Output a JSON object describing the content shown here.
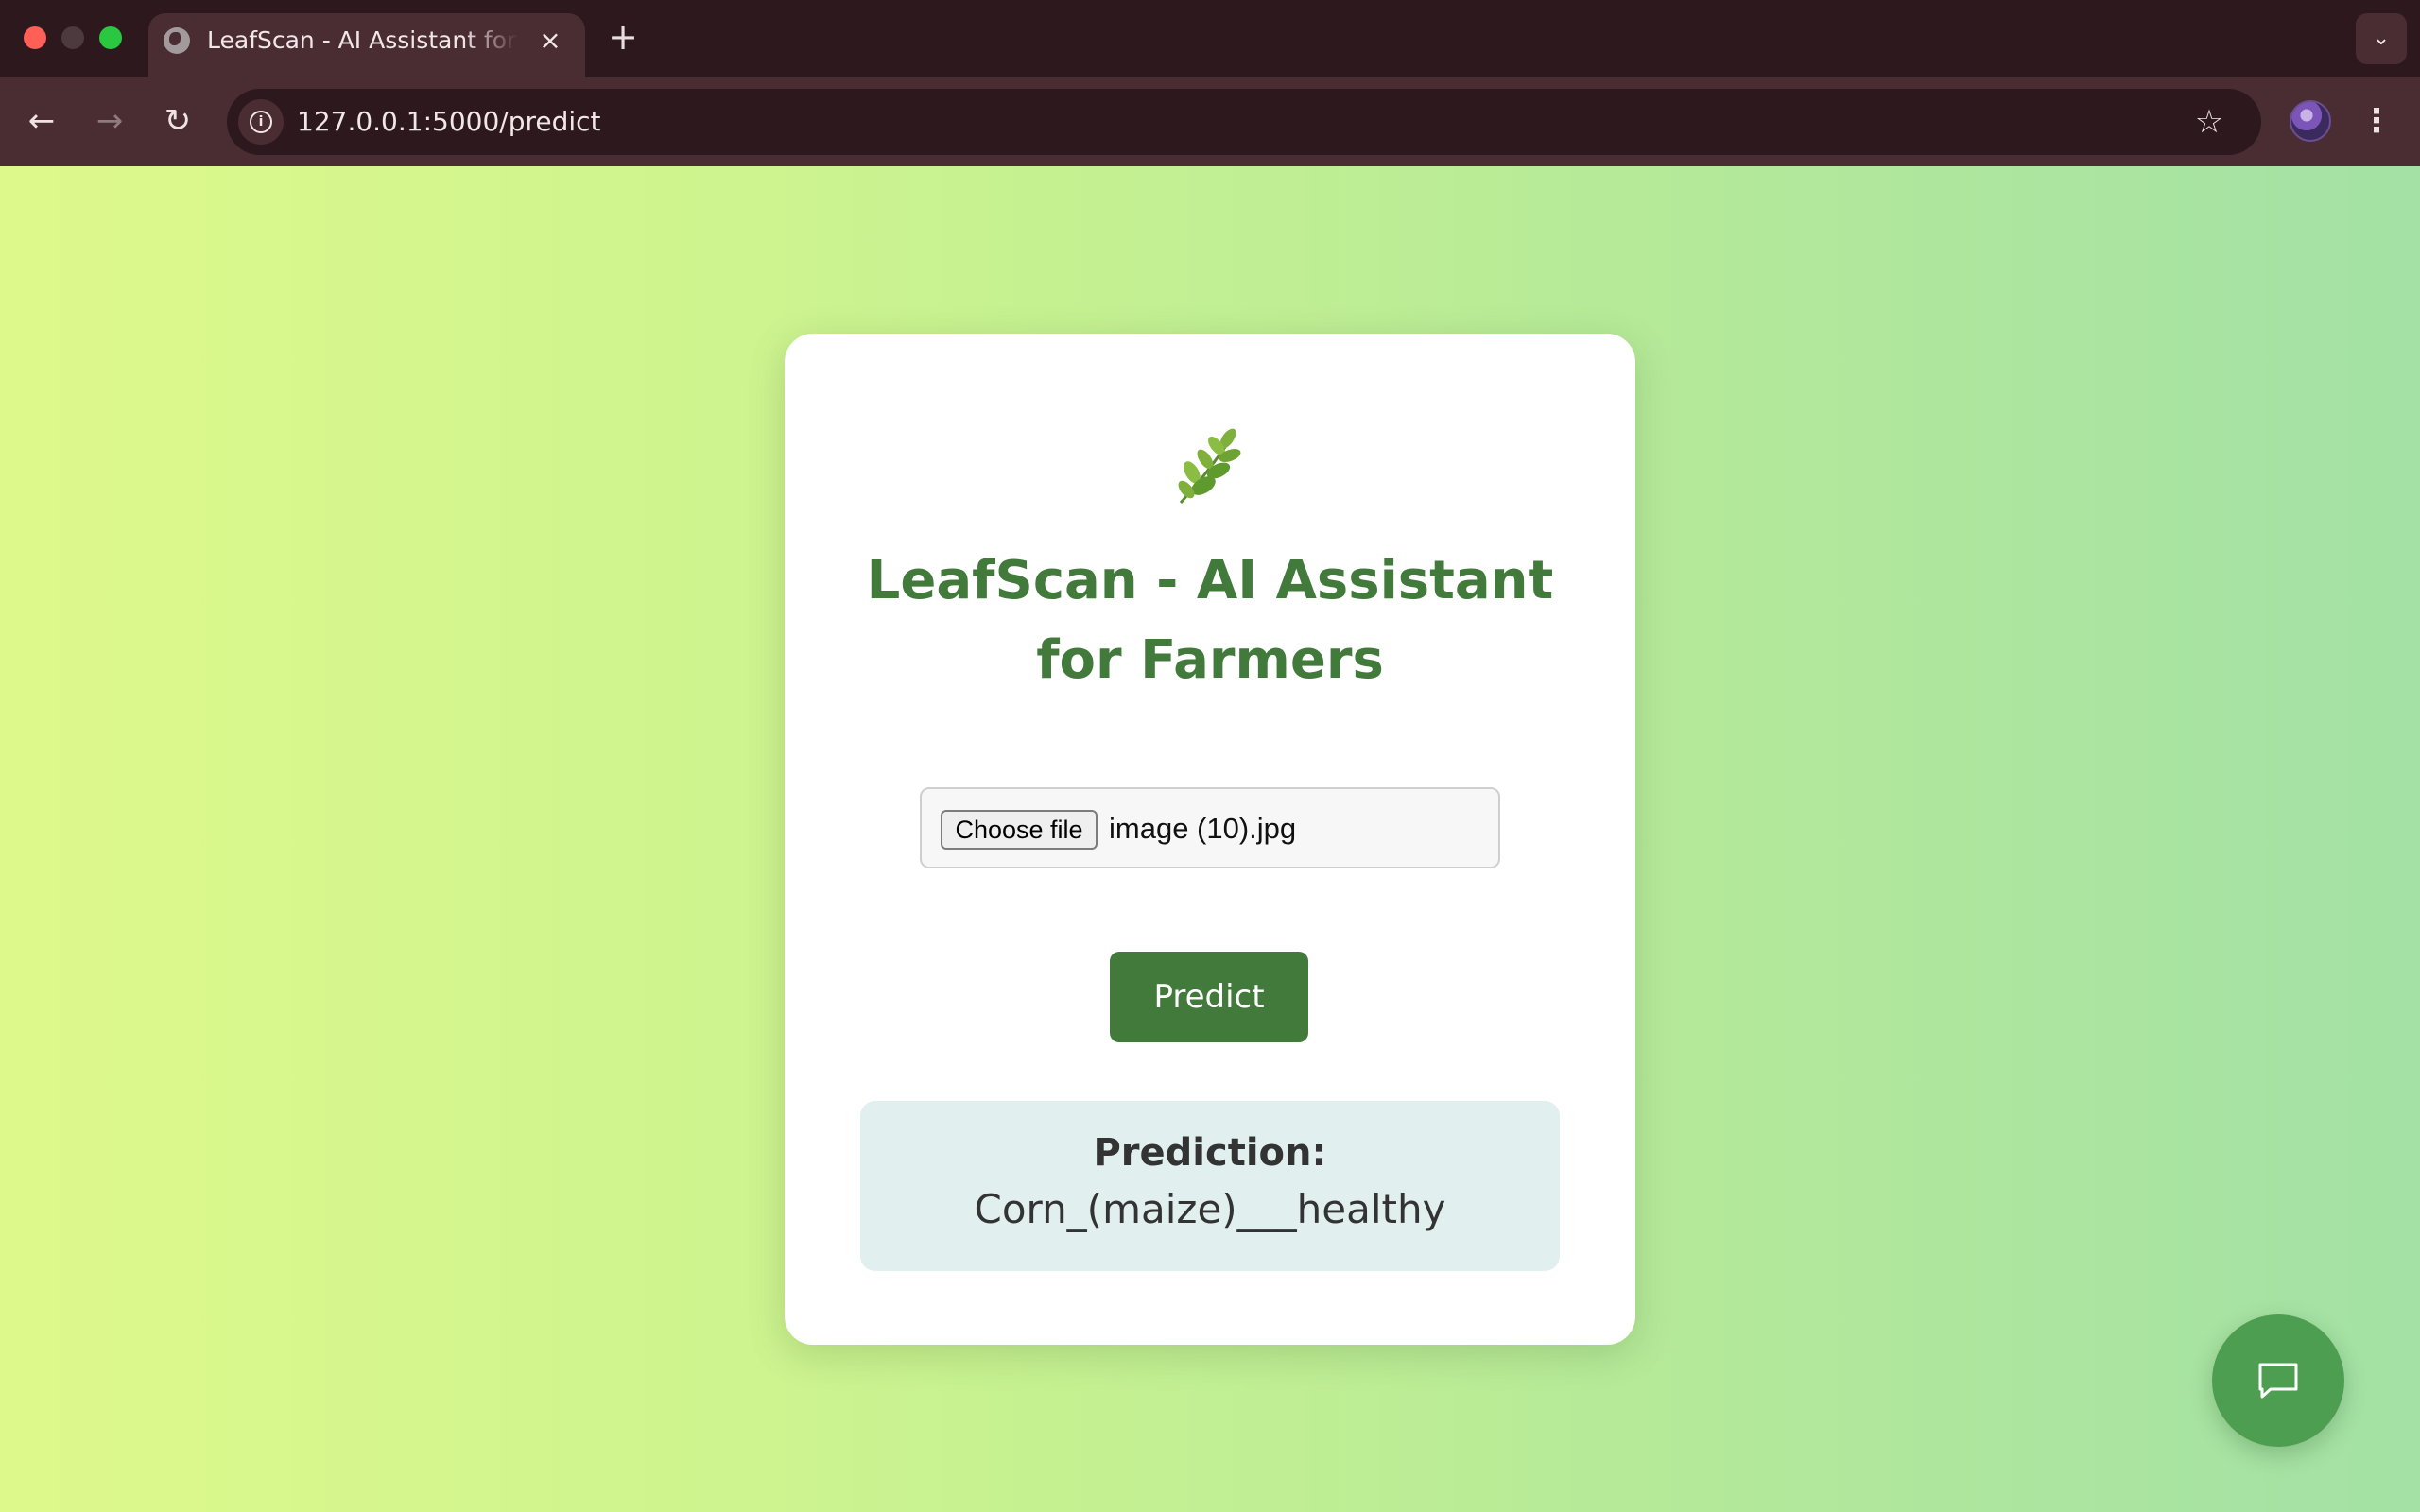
{
  "browser": {
    "tab": {
      "title": "LeafScan - AI Assistant for Farmers",
      "close_glyph": "×"
    },
    "new_tab_glyph": "+",
    "tab_dropdown_glyph": "⌄",
    "nav": {
      "back_glyph": "←",
      "forward_glyph": "→",
      "reload_glyph": "↻"
    },
    "url": "127.0.0.1:5000/predict",
    "info_glyph": "i",
    "bookmark_glyph": "☆",
    "menu_glyph": "⋮"
  },
  "page": {
    "app_icon": "herb-leaf-icon",
    "title": "LeafScan - AI Assistant for Farmers",
    "file_input": {
      "button_label": "Choose file",
      "file_name": "image (10).jpg"
    },
    "predict_label": "Predict",
    "result": {
      "label": "Prediction:",
      "value": "Corn_(maize)___healthy"
    },
    "chat_icon": "chat-bubble-icon"
  },
  "colors": {
    "brand_green": "#417a3b",
    "fab_green": "#4e9e52",
    "result_bg": "#e1f0ef",
    "gradient_start": "#def98b",
    "gradient_end": "#a3e1a5"
  }
}
